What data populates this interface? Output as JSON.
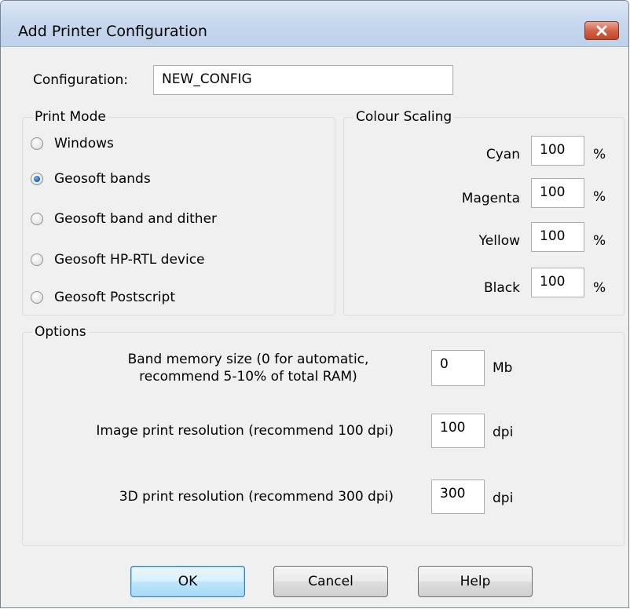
{
  "window": {
    "title": "Add Printer Configuration"
  },
  "configuration": {
    "label": "Configuration:",
    "value": "NEW_CONFIG"
  },
  "print_mode": {
    "title": "Print Mode",
    "options": [
      {
        "label": "Windows",
        "selected": false
      },
      {
        "label": "Geosoft bands",
        "selected": true
      },
      {
        "label": "Geosoft band and dither",
        "selected": false
      },
      {
        "label": "Geosoft HP-RTL device",
        "selected": false
      },
      {
        "label": "Geosoft Postscript",
        "selected": false
      }
    ]
  },
  "colour_scaling": {
    "title": "Colour Scaling",
    "unit": "%",
    "rows": [
      {
        "label": "Cyan",
        "value": "100"
      },
      {
        "label": "Magenta",
        "value": "100"
      },
      {
        "label": "Yellow",
        "value": "100"
      },
      {
        "label": "Black",
        "value": "100"
      }
    ]
  },
  "options": {
    "title": "Options",
    "band_memory": {
      "label_line1": "Band memory size (0 for automatic,",
      "label_line2": "recommend 5-10% of total RAM)",
      "value": "0",
      "unit": "Mb"
    },
    "image_resolution": {
      "label": "Image print resolution (recommend 100 dpi)",
      "value": "100",
      "unit": "dpi"
    },
    "threed_resolution": {
      "label": "3D print resolution (recommend 300 dpi)",
      "value": "300",
      "unit": "dpi"
    }
  },
  "buttons": {
    "ok": "OK",
    "cancel": "Cancel",
    "help": "Help"
  },
  "colors": {
    "titlebar": "#c8d9ee",
    "close": "#c44424",
    "default_button_border": "#3c7fb1",
    "dialog_bg": "#f0f0f0"
  }
}
